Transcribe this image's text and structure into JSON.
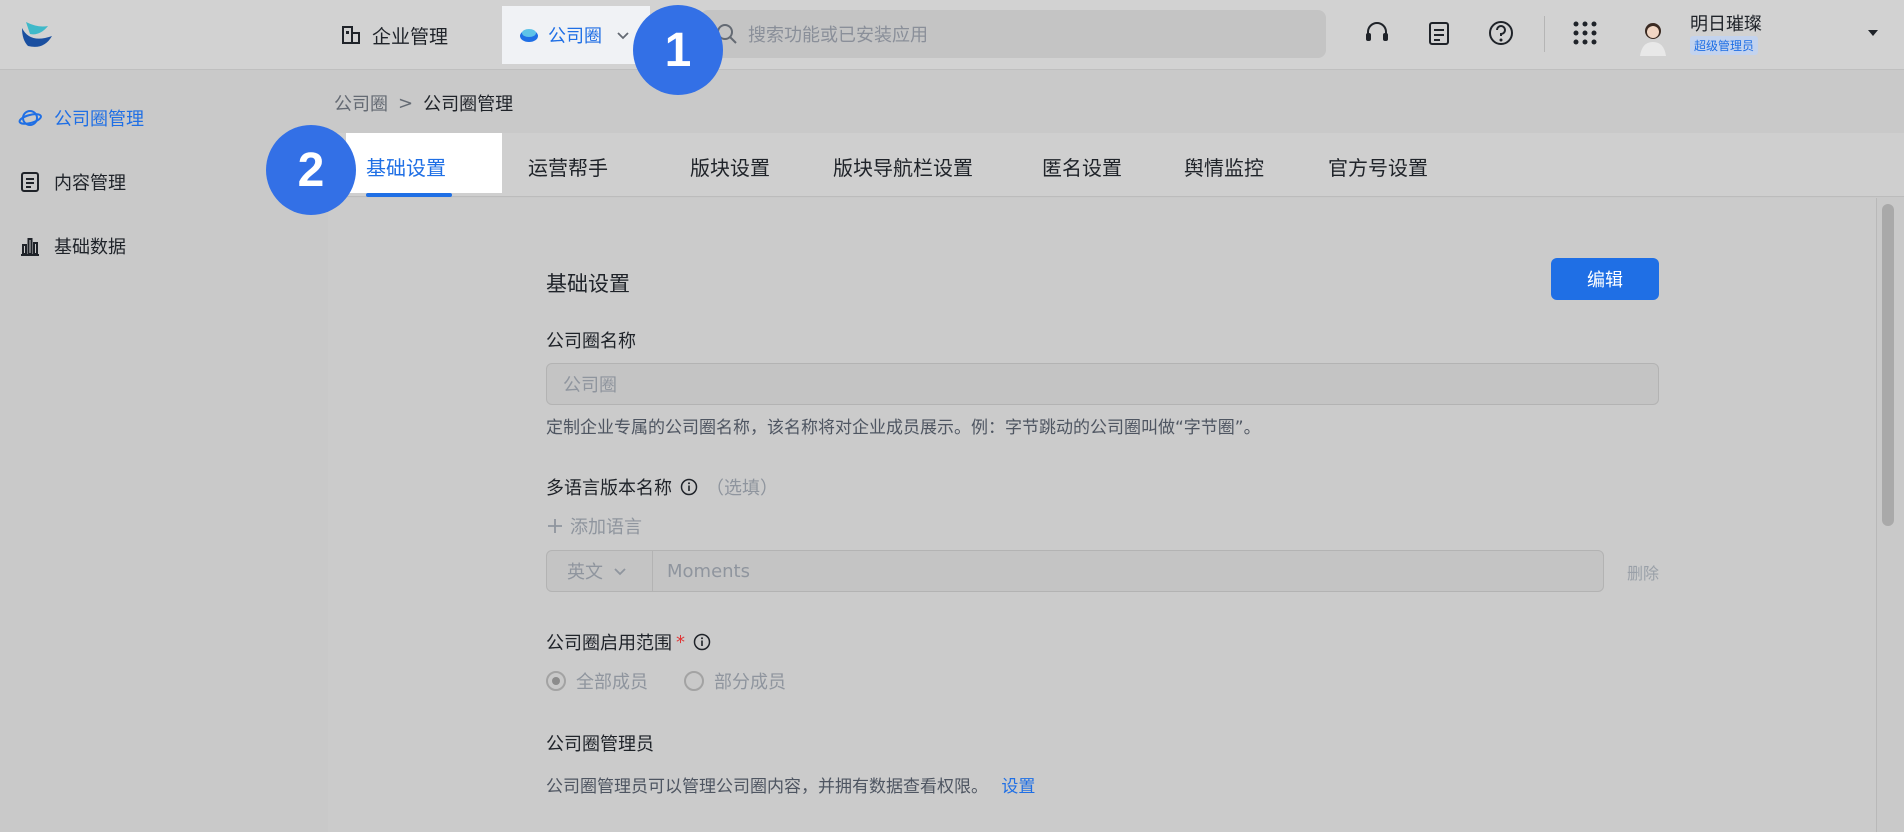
{
  "topbar": {
    "company_label": "企业管理",
    "app_label": "公司圈",
    "search_placeholder": "搜索功能或已安装应用",
    "user_name": "明日璀璨",
    "user_role": "超级管理员",
    "icons": [
      "headset-icon",
      "clipboard-icon",
      "help-icon",
      "apps-grid-icon"
    ]
  },
  "badges": [
    "1",
    "2"
  ],
  "sidebar": {
    "items": [
      {
        "label": "公司圈管理",
        "icon": "planet-icon",
        "active": true
      },
      {
        "label": "内容管理",
        "icon": "document-icon",
        "active": false
      },
      {
        "label": "基础数据",
        "icon": "bar-chart-icon",
        "active": false
      }
    ]
  },
  "breadcrumb": {
    "parent": "公司圈",
    "separator": ">",
    "current": "公司圈管理"
  },
  "tabs": [
    {
      "label": "基础设置",
      "active": true
    },
    {
      "label": "运营帮手",
      "active": false
    },
    {
      "label": "版块设置",
      "active": false
    },
    {
      "label": "版块导航栏设置",
      "active": false
    },
    {
      "label": "匿名设置",
      "active": false
    },
    {
      "label": "舆情监控",
      "active": false
    },
    {
      "label": "官方号设置",
      "active": false
    }
  ],
  "form": {
    "section_title": "基础设置",
    "edit_label": "编辑",
    "name_label": "公司圈名称",
    "name_value": "公司圈",
    "name_help": "定制企业专属的公司圈名称，该名称将对企业成员展示。例：字节跳动的公司圈叫做“字节圈”。",
    "multilang_label": "多语言版本名称",
    "multilang_optional": "（选填）",
    "add_language": "添加语言",
    "language_option": "英文",
    "language_value": "Moments",
    "delete_label": "删除",
    "scope_label": "公司圈启用范围",
    "scope_required": "*",
    "scope_options": [
      {
        "label": "全部成员",
        "selected": true
      },
      {
        "label": "部分成员",
        "selected": false
      }
    ],
    "admin_label": "公司圈管理员",
    "admin_help": "公司圈管理员可以管理公司圈内容，并拥有数据查看权限。",
    "admin_link": "设置"
  },
  "colors": {
    "accent": "#1f6fe5",
    "badge": "#3370e6",
    "required": "#e03535"
  }
}
